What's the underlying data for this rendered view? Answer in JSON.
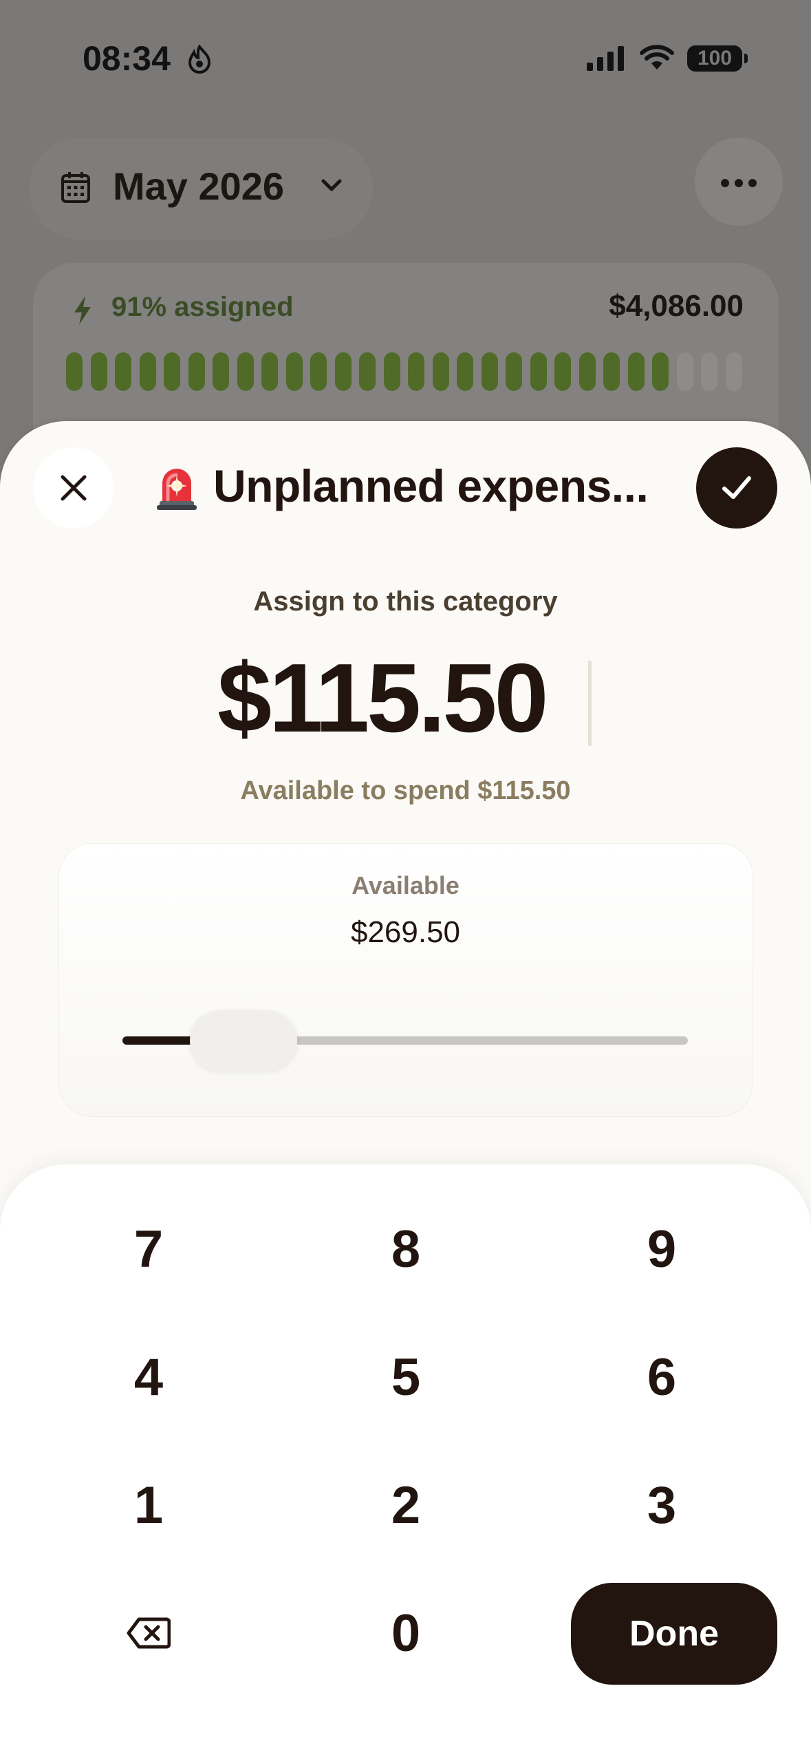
{
  "status_bar": {
    "time": "08:34",
    "battery": "100"
  },
  "header": {
    "month": "May 2026"
  },
  "assigned_card": {
    "label": "91% assigned",
    "amount": "$4,086.00",
    "progress_fraction": 0.91,
    "segments_total": 28,
    "segments_filled": 25,
    "fill_color": "#4f6b27"
  },
  "sheet": {
    "category_emoji": "🚨",
    "title": "Unplanned expens...",
    "assign_label": "Assign to this category",
    "amount": "$115.50",
    "available_to_spend": "Available to spend $115.50",
    "available_label": "Available",
    "available_value": "$269.50",
    "slider_fraction": 0.2
  },
  "keypad": {
    "keys": [
      "7",
      "8",
      "9",
      "4",
      "5",
      "6",
      "1",
      "2",
      "3",
      "0"
    ],
    "done_label": "Done"
  },
  "colors": {
    "dark": "#22150f",
    "sheet_bg": "#fbfaf7",
    "accent_green": "#4f6b27"
  }
}
